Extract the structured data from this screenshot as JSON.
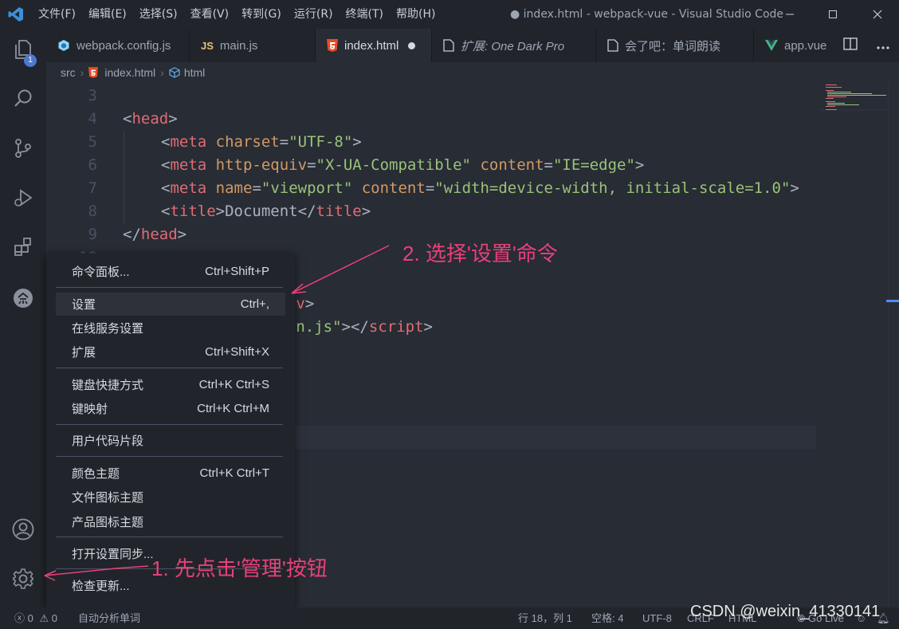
{
  "window": {
    "title": "● index.html - webpack-vue - Visual Studio Code"
  },
  "menubar": [
    "文件(F)",
    "编辑(E)",
    "选择(S)",
    "查看(V)",
    "转到(G)",
    "运行(R)",
    "终端(T)",
    "帮助(H)"
  ],
  "activity": {
    "explorer_badge": "1"
  },
  "tabs": [
    {
      "label": "webpack.config.js",
      "icon": "webpack-icon"
    },
    {
      "label": "main.js",
      "icon": "js-icon",
      "icon_text": "JS"
    },
    {
      "label": "index.html",
      "icon": "html5-icon",
      "active": true,
      "dirty": true
    },
    {
      "label": "扩展: One Dark Pro",
      "icon": "file-icon",
      "italic": true
    },
    {
      "label": "会了吧：单词朗读",
      "icon": "file-icon"
    },
    {
      "label": "app.vue",
      "icon": "vue-icon"
    }
  ],
  "breadcrumb": [
    "src",
    "index.html",
    "html"
  ],
  "editor": {
    "lines": [
      {
        "n": "3",
        "tokens": []
      },
      {
        "n": "4",
        "indent": 0,
        "tokens": [
          [
            "pn",
            "<"
          ],
          [
            "tg",
            "head"
          ],
          [
            "pn",
            ">"
          ]
        ]
      },
      {
        "n": "5",
        "indent": 1,
        "tokens": [
          [
            "pn",
            "<"
          ],
          [
            "tg",
            "meta"
          ],
          [
            "tx",
            " "
          ],
          [
            "at",
            "charset"
          ],
          [
            "pn",
            "="
          ],
          [
            "st",
            "\"UTF-8\""
          ],
          [
            "pn",
            ">"
          ]
        ]
      },
      {
        "n": "6",
        "indent": 1,
        "tokens": [
          [
            "pn",
            "<"
          ],
          [
            "tg",
            "meta"
          ],
          [
            "tx",
            " "
          ],
          [
            "at",
            "http-equiv"
          ],
          [
            "pn",
            "="
          ],
          [
            "st",
            "\"X-UA-Compatible\""
          ],
          [
            "tx",
            " "
          ],
          [
            "at",
            "content"
          ],
          [
            "pn",
            "="
          ],
          [
            "st",
            "\"IE=edge\""
          ],
          [
            "pn",
            ">"
          ]
        ]
      },
      {
        "n": "7",
        "indent": 1,
        "tokens": [
          [
            "pn",
            "<"
          ],
          [
            "tg",
            "meta"
          ],
          [
            "tx",
            " "
          ],
          [
            "at",
            "name"
          ],
          [
            "pn",
            "="
          ],
          [
            "st",
            "\"viewport\""
          ],
          [
            "tx",
            " "
          ],
          [
            "at",
            "content"
          ],
          [
            "pn",
            "="
          ],
          [
            "st",
            "\"width=device-width, initial-scale=1.0\""
          ],
          [
            "pn",
            ">"
          ]
        ]
      },
      {
        "n": "8",
        "indent": 1,
        "tokens": [
          [
            "pn",
            "<"
          ],
          [
            "tg",
            "title"
          ],
          [
            "pn",
            ">"
          ],
          [
            "tx",
            "Document"
          ],
          [
            "pn",
            "</"
          ],
          [
            "tg",
            "title"
          ],
          [
            "pn",
            ">"
          ]
        ]
      },
      {
        "n": "9",
        "indent": 0,
        "tokens": [
          [
            "pn",
            "</"
          ],
          [
            "tg",
            "head"
          ],
          [
            "pn",
            ">"
          ]
        ]
      },
      {
        "n": "10",
        "tokens": []
      },
      {
        "n": "",
        "tokens": []
      },
      {
        "n": "",
        "tokens": [
          [
            "tx",
            "               "
          ],
          [
            "pn",
            "</"
          ],
          [
            "tg",
            "div"
          ],
          [
            "pn",
            ">"
          ]
        ]
      },
      {
        "n": "",
        "tokens": [
          [
            "tx",
            "               "
          ],
          [
            "st",
            "/main.js\""
          ],
          [
            "pn",
            "></"
          ],
          [
            "tg",
            "script"
          ],
          [
            "pn",
            ">"
          ]
        ]
      }
    ]
  },
  "context_menu": {
    "items": [
      {
        "label": "命令面板...",
        "shortcut": "Ctrl+Shift+P"
      },
      {
        "label": "设置",
        "shortcut": "Ctrl+,",
        "selected": true
      },
      {
        "label": "在线服务设置",
        "shortcut": ""
      },
      {
        "label": "扩展",
        "shortcut": "Ctrl+Shift+X"
      },
      {
        "label": "键盘快捷方式",
        "shortcut": "Ctrl+K Ctrl+S"
      },
      {
        "label": "键映射",
        "shortcut": "Ctrl+K Ctrl+M"
      },
      {
        "label": "用户代码片段",
        "shortcut": ""
      },
      {
        "label": "颜色主题",
        "shortcut": "Ctrl+K Ctrl+T"
      },
      {
        "label": "文件图标主题",
        "shortcut": ""
      },
      {
        "label": "产品图标主题",
        "shortcut": ""
      },
      {
        "label": "打开设置同步...",
        "shortcut": ""
      },
      {
        "label": "检查更新...",
        "shortcut": ""
      }
    ]
  },
  "annotations": {
    "step2": "2. 选择'设置'命令",
    "step1": "1. 先点击'管理'按钮"
  },
  "statusbar": {
    "errors": "0",
    "warnings": "0",
    "word_reader": "自动分析单词",
    "position": "行 18，列 1",
    "spaces": "空格: 4",
    "encoding": "UTF-8",
    "eol": "CRLF",
    "language": "HTML",
    "golive": "Go Live"
  },
  "watermark": "CSDN @weixin_41330141",
  "colors": {
    "accent": "#528bff",
    "annotation": "#e8407a",
    "badge": "#4d78cc"
  }
}
